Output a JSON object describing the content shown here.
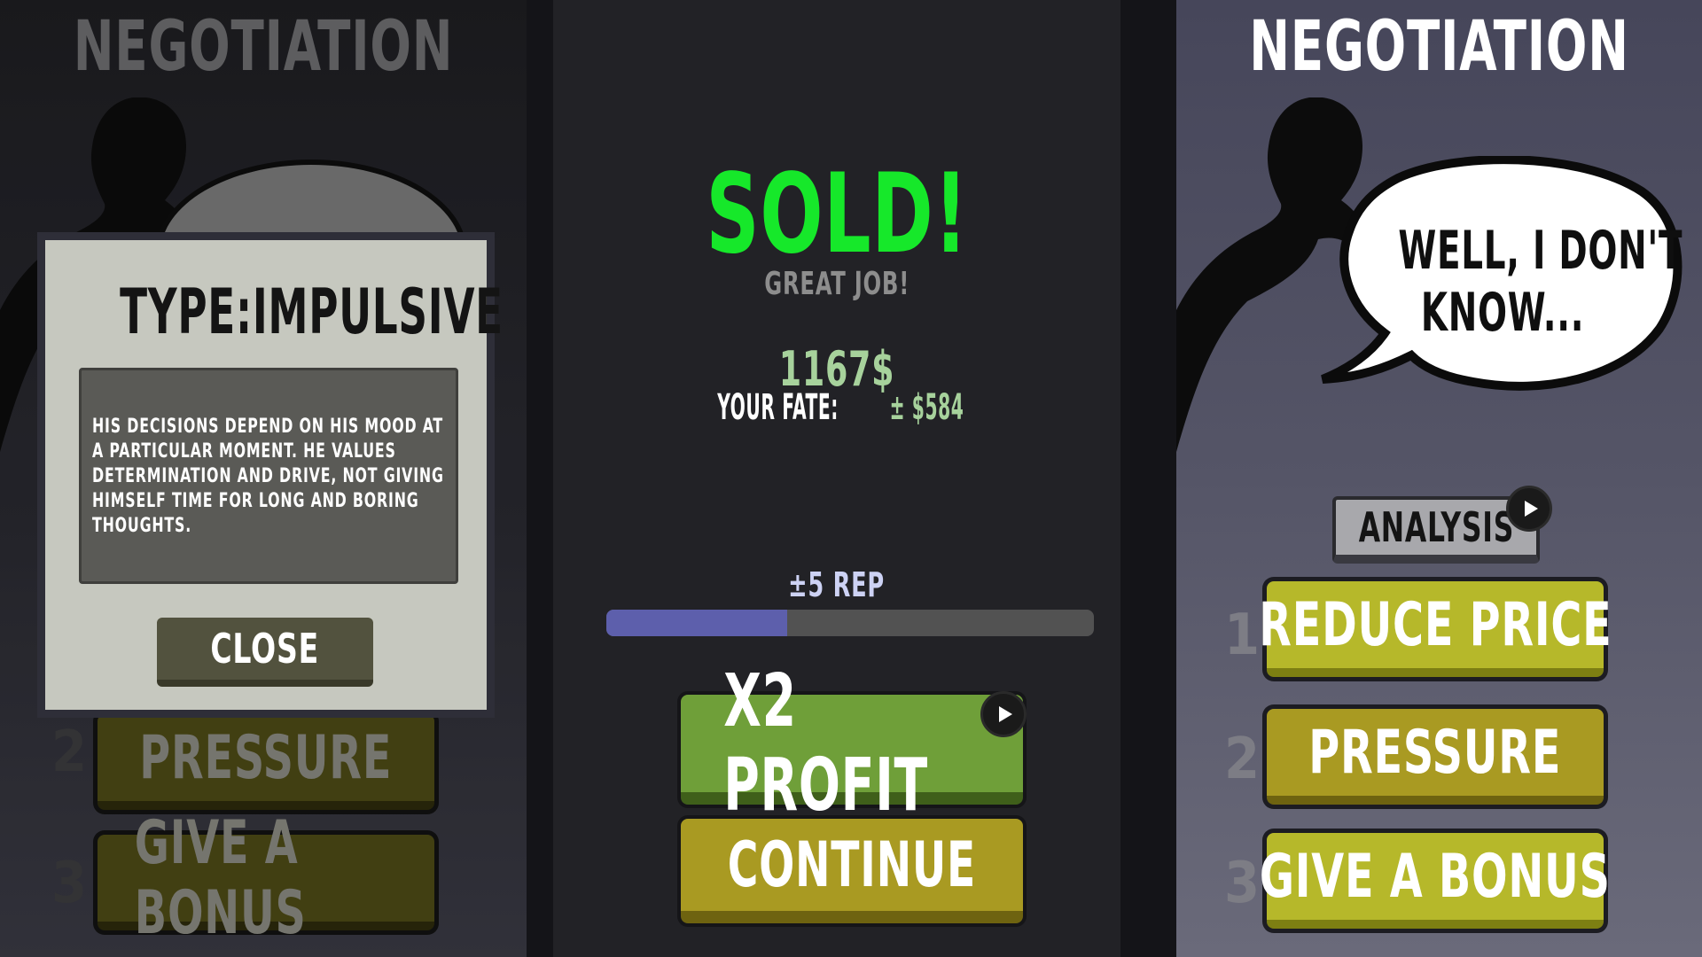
{
  "left_panel": {
    "title": "NEGOTIATION",
    "options": [
      {
        "number": "2",
        "label": "PRESSURE"
      },
      {
        "number": "3",
        "label": "GIVE A BONUS"
      }
    ],
    "popup": {
      "title": "TYPE:IMPULSIVE",
      "description": "HIS DECISIONS DEPEND ON HIS MOOD AT A PARTICULAR MOMENT. HE VALUES DETERMINATION AND DRIVE, NOT GIVING HIMSELF TIME FOR LONG AND BORING THOUGHTS.",
      "close_label": "CLOSE"
    }
  },
  "middle_panel": {
    "headline": "SOLD!",
    "subheadline": "GREAT JOB!",
    "amount": "1167$",
    "fate_label": "YOUR FATE:",
    "fate_value": "± $584",
    "rep_label": "±5 REP",
    "rep_progress": 0.37,
    "x2_profit_label": "X2 PROFIT",
    "continue_label": "CONTINUE"
  },
  "right_panel": {
    "title": "NEGOTIATION",
    "speech_line1": "WELL, I DON'T",
    "speech_line2": "KNOW...",
    "analysis_label": "ANALYSIS",
    "options": [
      {
        "number": "1",
        "label": "REDUCE PRICE"
      },
      {
        "number": "2",
        "label": "PRESSURE"
      },
      {
        "number": "3",
        "label": "GIVE A BONUS"
      }
    ]
  },
  "colors": {
    "sold_green": "#16e82a",
    "money_green": "#a7d29c",
    "rep_bar": "#5d5fac",
    "x2_button": "#6f9f39",
    "continue_button": "#a99a22",
    "option_button": "#b6b82a"
  },
  "icons": [
    "play-icon",
    "person-silhouette"
  ]
}
